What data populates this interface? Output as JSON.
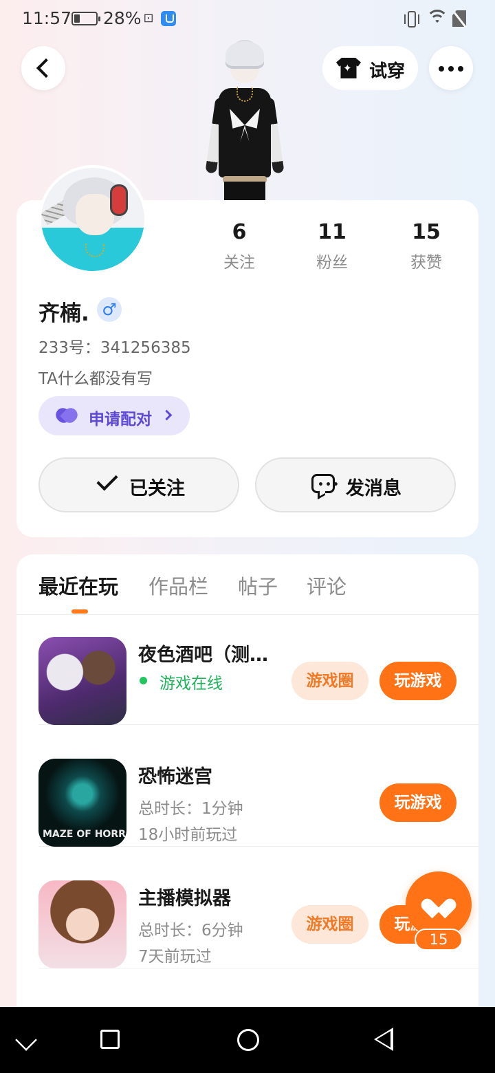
{
  "status_bar": {
    "time": "11:57",
    "battery": "28%",
    "battery_level": 0.28
  },
  "top_bar": {
    "try_on_label": "试穿"
  },
  "profile": {
    "stats": [
      {
        "value": "6",
        "label": "关注"
      },
      {
        "value": "11",
        "label": "粉丝"
      },
      {
        "value": "15",
        "label": "获赞"
      }
    ],
    "name": "齐楠.",
    "gender_symbol": "♂",
    "uid": "233号：341256385",
    "bio": "TA什么都没有写",
    "pair_label": "申请配对",
    "follow_label": "已关注",
    "message_label": "发消息"
  },
  "tabs": [
    "最近在玩",
    "作品栏",
    "帖子",
    "评论"
  ],
  "games": [
    {
      "title": "夜色酒吧（测…",
      "status": "游戏在线",
      "circle_label": "游戏圈",
      "play_label": "玩游戏"
    },
    {
      "title": "恐怖迷宫",
      "icon_text": "MAZE OF HORROR",
      "duration": "总时长：1分钟",
      "last_played": "18小时前玩过",
      "play_label": "玩游戏"
    },
    {
      "title": "主播模拟器",
      "duration": "总时长：6分钟",
      "last_played": "7天前玩过",
      "circle_label": "游戏圈",
      "play_label": "玩游戏"
    }
  ],
  "like": {
    "count": "15"
  },
  "colors": {
    "accent": "#ff7216",
    "pair": "#5e49d6",
    "online": "#1fb45a"
  }
}
